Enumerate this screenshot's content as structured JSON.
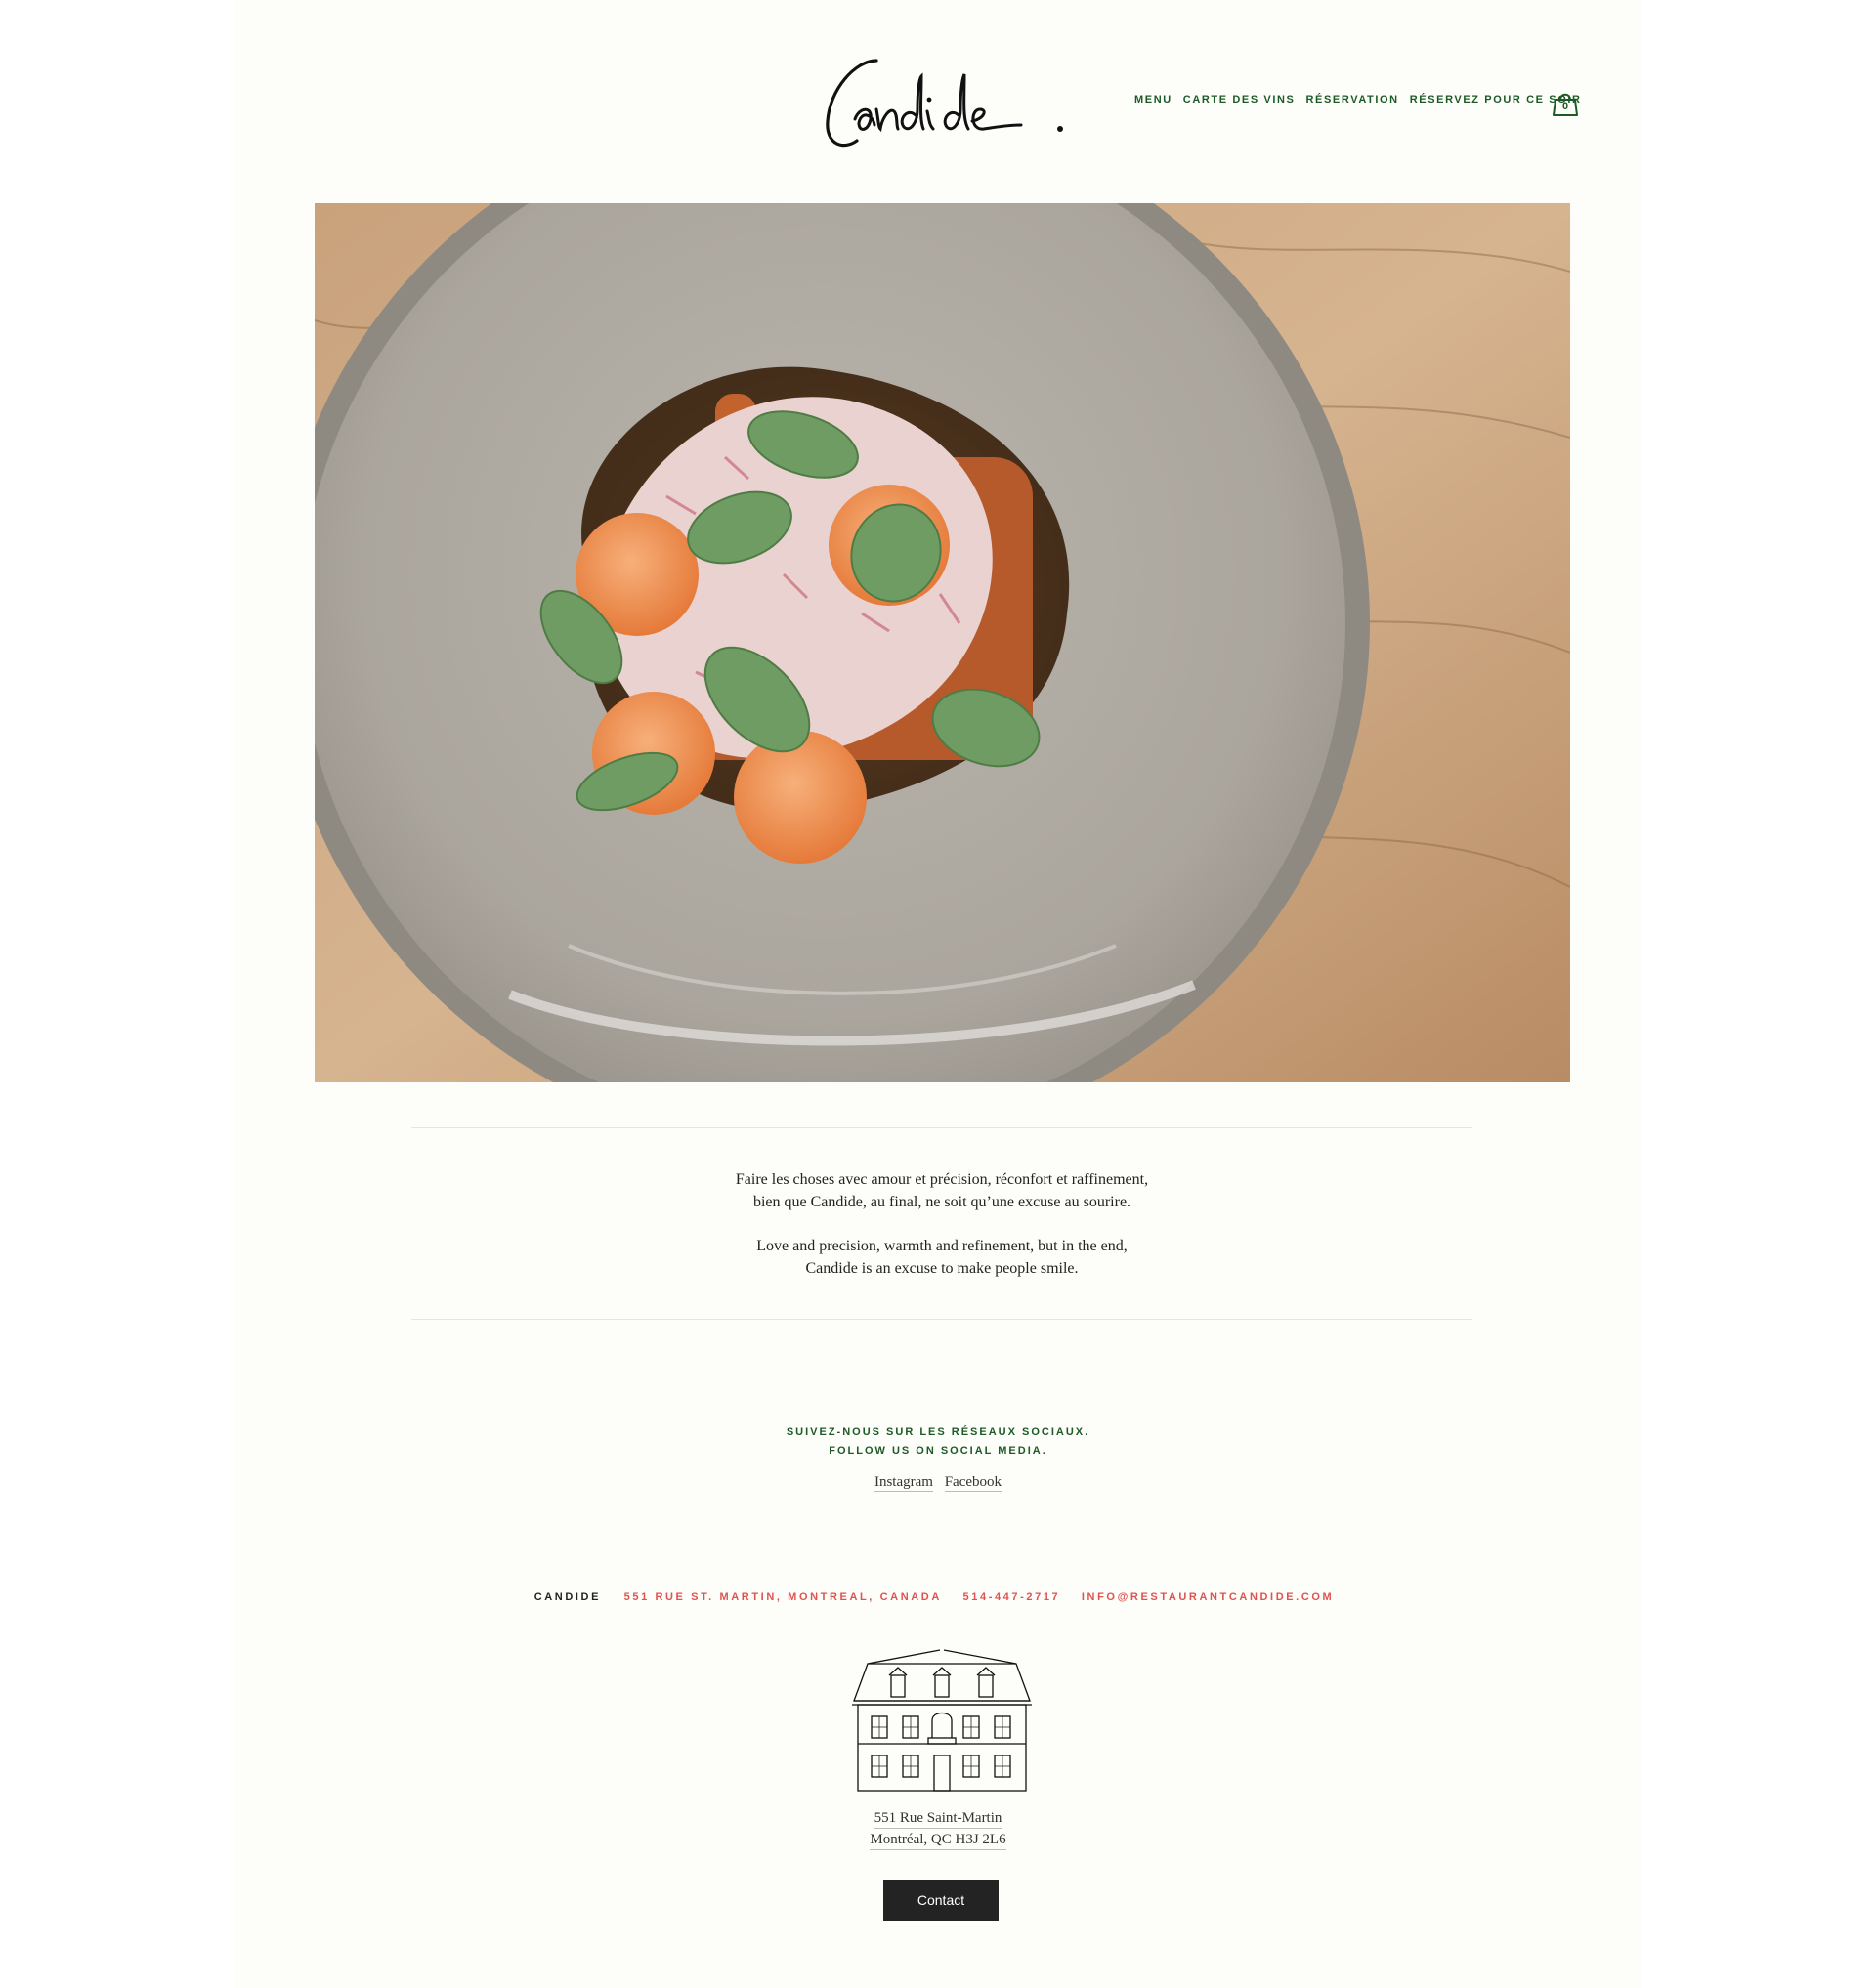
{
  "header": {
    "logo_text": "Candide.",
    "nav": [
      {
        "label": "MENU"
      },
      {
        "label": "CARTE DES VINS"
      },
      {
        "label": "RÉSERVATION"
      },
      {
        "label": "RÉSERVEZ POUR CE SOIR"
      }
    ],
    "cart_count": "0"
  },
  "intro": {
    "fr_line1": "Faire les choses avec amour et précision, réconfort et raffinement,",
    "fr_line2": "bien que Candide, au final, ne soit qu’une excuse au sourire.",
    "en_line1": "Love and precision, warmth and refinement, but in the end,",
    "en_line2": "Candide is an excuse to make people smile."
  },
  "social": {
    "heading_fr": "SUIVEZ-NOUS SUR LES RÉSEAUX SOCIAUX.",
    "heading_en": "FOLLOW US ON SOCIAL MEDIA.",
    "links": [
      "Instagram",
      "Facebook"
    ]
  },
  "contact": {
    "brand": "CANDIDE",
    "address": "551 RUE ST. MARTIN, MONTREAL, CANADA",
    "phone": "514-447-2717",
    "email": "INFO@RESTAURANTCANDIDE.COM"
  },
  "address_block": {
    "line1": "551 Rue Saint-Martin",
    "line2": "Montréal, QC H3J 2L6"
  },
  "contact_button": "Contact",
  "colors": {
    "nav_green": "#1d5a26",
    "contact_red": "#e0524e",
    "page_background": "#fdfdfa",
    "button_background": "#232323"
  }
}
